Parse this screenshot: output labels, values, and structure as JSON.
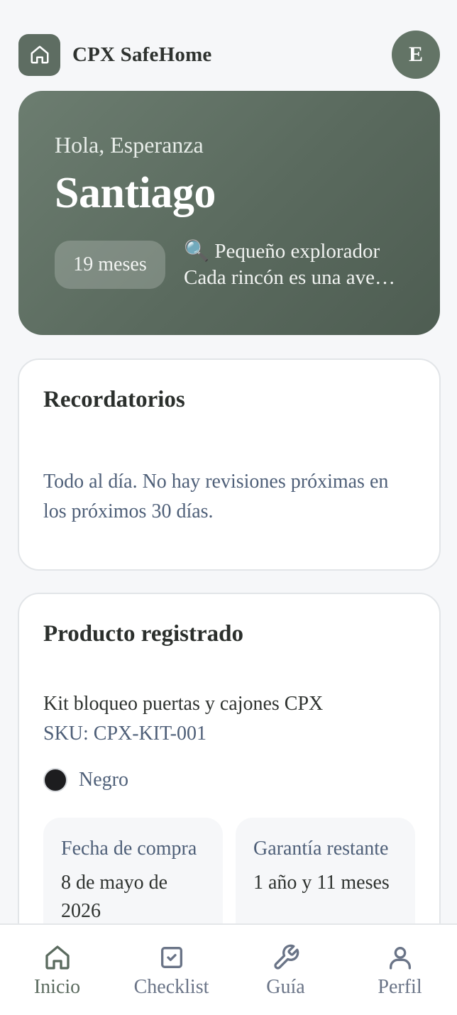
{
  "app": {
    "title": "CPX SafeHome",
    "avatar_initial": "E"
  },
  "hero": {
    "greeting": "Hola, Esperanza",
    "child_name": "Santiago",
    "age": "19 meses",
    "stage_title": "🔍 Pequeño explorador",
    "stage_subtitle": "Cada rincón es una aventura"
  },
  "reminders": {
    "title": "Recordatorios",
    "empty_text": "Todo al día. No hay revisiones próximas en los próximos 30 días."
  },
  "product": {
    "title": "Producto registrado",
    "name": "Kit bloqueo puertas y cajones CPX",
    "sku": "SKU: CPX-KIT-001",
    "color_label": "Negro",
    "color_hex": "#1d1d1f",
    "purchase_label": "Fecha de compra",
    "purchase_value": "8 de mayo de 2026",
    "warranty_label": "Garantía restante",
    "warranty_value": "1 año y 11 meses"
  },
  "nav": {
    "home": "Inicio",
    "checklist": "Checklist",
    "guide": "Guía",
    "profile": "Perfil"
  },
  "colors": {
    "accent": "#5e6d62",
    "muted_text": "#4e5f78"
  }
}
